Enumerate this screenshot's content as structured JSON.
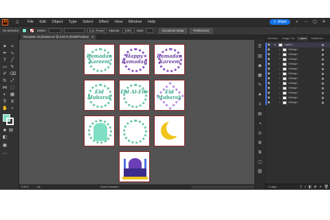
{
  "menubar": {
    "items": [
      "File",
      "Edit",
      "Object",
      "Type",
      "Select",
      "Effect",
      "View",
      "Window",
      "Help"
    ],
    "share_label": "Share"
  },
  "control": {
    "selection": "No Selection",
    "stroke_label": "Stroke:",
    "brush": "5 pt. Round",
    "opacity_label": "Opacity:",
    "opacity_value": "100%",
    "style_label": "Style:",
    "doc_setup": "Document Setup",
    "preferences": "Preferences"
  },
  "document": {
    "tab_title": "Ramadan 10 phrases.ai* @ 8.33 % (RGB/Preview)"
  },
  "artboards": [
    {
      "text": "Ramadan Kareem",
      "style": "green-wreath"
    },
    {
      "text": "Happy Ramadan",
      "style": "purple-wreath"
    },
    {
      "text": "Ramadan Kareem",
      "style": "purple-wreath"
    },
    {
      "text": "Eid Mubarak",
      "style": "green-wreath"
    },
    {
      "text": "Eid Al-Fitr",
      "style": "green-wreath"
    },
    {
      "text": "Eid Mubarak",
      "style": "square-wreath"
    },
    {
      "text": "",
      "style": "mosque-sign"
    },
    {
      "text": "",
      "style": "plain-wreath"
    },
    {
      "text": "",
      "style": "moon"
    },
    {
      "text": "",
      "style": "mosque"
    }
  ],
  "status": {
    "zoom": "8.33%",
    "tool": "Direct Selection"
  },
  "layers_panel": {
    "tabs": [
      "Libraries",
      "Image Tra",
      "Layers",
      "Swatches"
    ],
    "active_tab": "Layers",
    "layer_name": "Layer 1",
    "groups": [
      "<Group>",
      "<Group>",
      "<Group>",
      "<Group>",
      "<Group>",
      "<Group>",
      "<Group>",
      "<Group>",
      "<Group>",
      "<Group>",
      "<Group>",
      "<Group>"
    ],
    "footer": "1 Layer"
  },
  "colors": {
    "fill": "#7fdfc4",
    "accent": "#1473e6",
    "artboard_border": "#8c1f1f",
    "layer_color": "#4a7bff"
  }
}
